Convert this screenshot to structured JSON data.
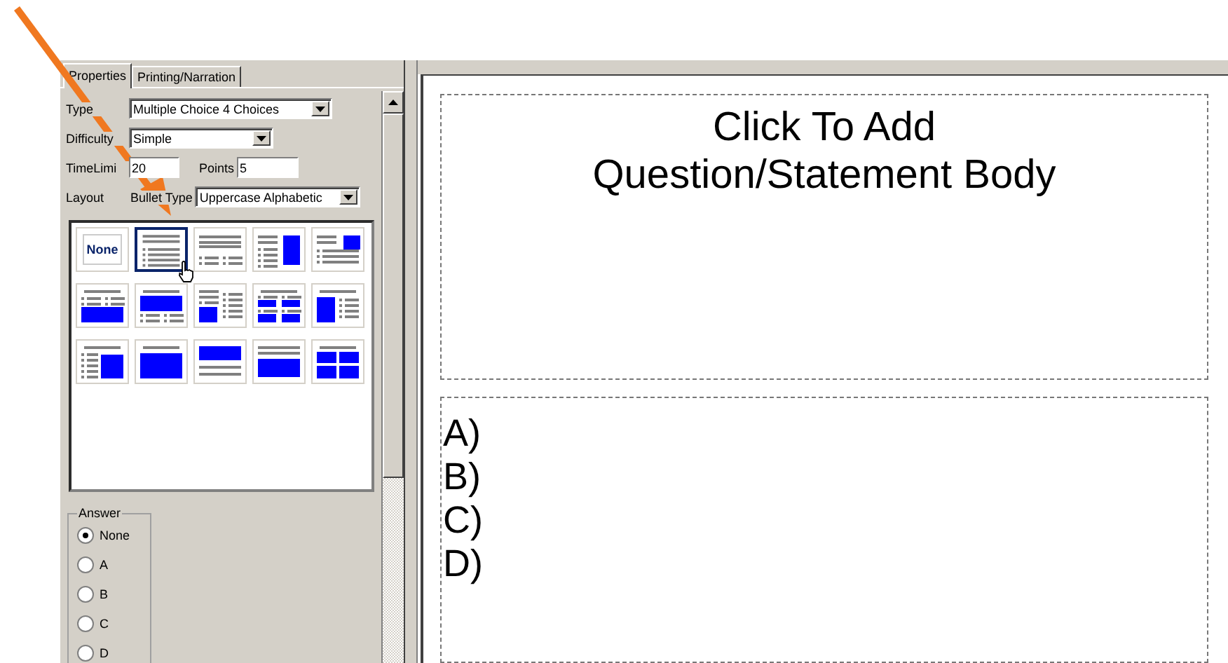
{
  "tabs": [
    {
      "label": "Properties",
      "selected": true
    },
    {
      "label": "Printing/Narration",
      "selected": false
    }
  ],
  "fields": {
    "type_label": "Type",
    "type_value": "Multiple Choice 4 Choices",
    "difficulty_label": "Difficulty",
    "difficulty_value": "Simple",
    "time_limit_label": "TimeLimi",
    "time_limit_value": "20",
    "points_label": "Points",
    "points_value": "5",
    "layout_label": "Layout",
    "bullet_type_label": "Bullet Type",
    "bullet_type_value": "Uppercase Alphabetic"
  },
  "layouts": [
    {
      "kind": "none",
      "label": "None",
      "selected": false
    },
    {
      "kind": "title-bullets",
      "selected": true
    },
    {
      "kind": "lines-bullets",
      "selected": false
    },
    {
      "kind": "bullets-pic-right",
      "selected": false
    },
    {
      "kind": "bullets-pic-corner",
      "selected": false
    },
    {
      "kind": "bullets-pic-bottom",
      "selected": false
    },
    {
      "kind": "pic-bullets-bottom",
      "selected": false
    },
    {
      "kind": "two-col-pic",
      "selected": false
    },
    {
      "kind": "four-pic-bullets",
      "selected": false
    },
    {
      "kind": "pic-left-bullets",
      "selected": false
    },
    {
      "kind": "bullets-pic-right-title",
      "selected": false
    },
    {
      "kind": "title-pic",
      "selected": false
    },
    {
      "kind": "pic-lines",
      "selected": false
    },
    {
      "kind": "lines-pic",
      "selected": false
    },
    {
      "kind": "four-pic",
      "selected": false
    }
  ],
  "answer": {
    "title": "Answer",
    "options": [
      {
        "label": "None",
        "selected": true
      },
      {
        "label": "A",
        "selected": false
      },
      {
        "label": "B",
        "selected": false
      },
      {
        "label": "C",
        "selected": false
      },
      {
        "label": "D",
        "selected": false
      }
    ]
  },
  "question_placeholder": "Click To Add\nQuestion/Statement Body",
  "choices": [
    "A)",
    "B)",
    "C)",
    "D)"
  ]
}
